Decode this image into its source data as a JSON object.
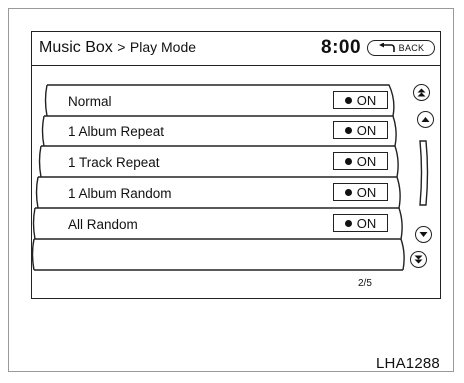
{
  "header": {
    "title": "Music Box",
    "separator": ">",
    "subtitle": "Play Mode",
    "clock": "8:00",
    "back_label": "BACK"
  },
  "list": {
    "items": [
      {
        "label": "Normal",
        "state": "ON"
      },
      {
        "label": "1 Album Repeat",
        "state": "ON"
      },
      {
        "label": "1 Track Repeat",
        "state": "ON"
      },
      {
        "label": "1 Album Random",
        "state": "ON"
      },
      {
        "label": "All Random",
        "state": "ON"
      }
    ],
    "page": "2/5"
  },
  "icons": {
    "page_up": "double-chevron-up-icon",
    "line_up": "chevron-up-icon",
    "line_down": "chevron-down-icon",
    "page_down": "double-chevron-down-icon",
    "back": "back-arrow-icon",
    "on_indicator": "filled-dot-icon"
  },
  "figure_label": "LHA1288"
}
